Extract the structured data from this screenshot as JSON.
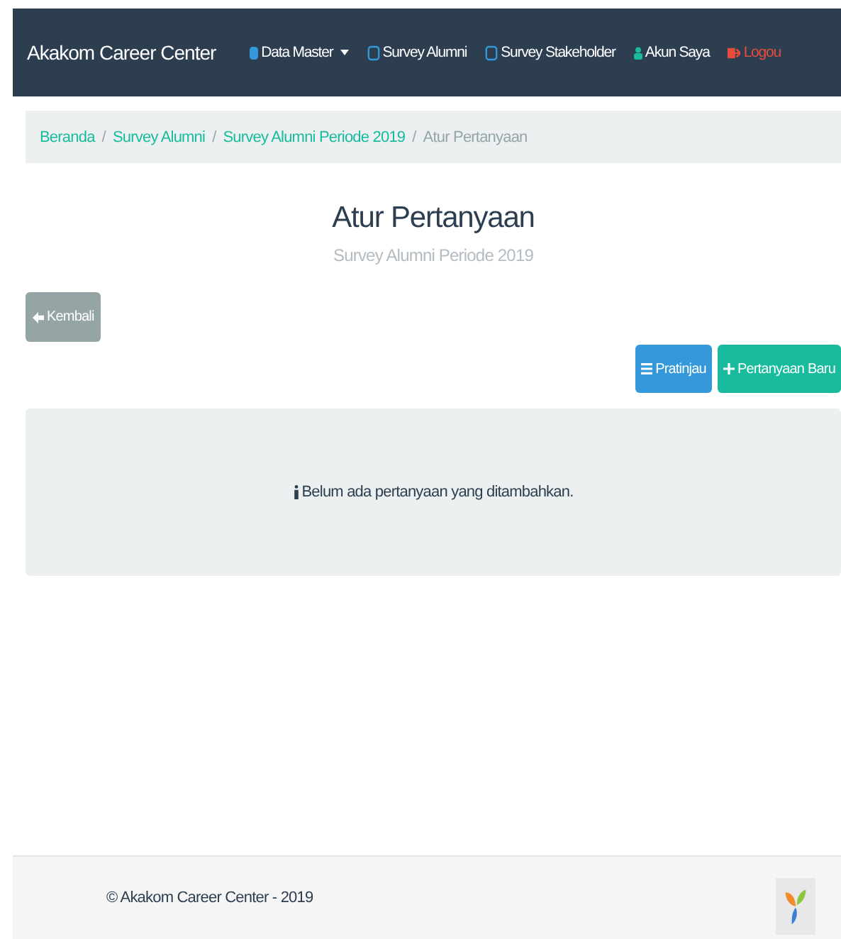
{
  "navbar": {
    "brand": "Akakom Career Center",
    "items": [
      {
        "label": "Data Master",
        "dropdown": true,
        "kind": "normal"
      },
      {
        "label": "Survey Alumni",
        "dropdown": false,
        "kind": "normal"
      },
      {
        "label": "Survey Stakeholder",
        "dropdown": false,
        "kind": "normal"
      },
      {
        "label": "Akun Saya",
        "dropdown": false,
        "kind": "normal"
      },
      {
        "label": "Logou",
        "dropdown": false,
        "kind": "danger"
      }
    ]
  },
  "breadcrumb_separators": [
    "/",
    "/",
    "/"
  ],
  "breadcrumb": [
    {
      "label": "Beranda",
      "active": false
    },
    {
      "label": "Survey Alumni",
      "active": false
    },
    {
      "label": "Survey Alumni Periode 2019",
      "active": false
    },
    {
      "label": "Atur Pertanyaan",
      "active": true
    }
  ],
  "page": {
    "title": "Atur Pertanyaan",
    "subtitle": "Survey Alumni Periode 2019"
  },
  "back_button": "Kembali",
  "actions": [
    {
      "label": "Pratinjau",
      "kind": "primary"
    },
    {
      "label": "Pertanyaan Baru",
      "kind": "success"
    }
  ],
  "empty_message": "Belum ada pertanyaan yang ditambahkan.",
  "footer": {
    "copyright": "© Akakom Career Center - 2019"
  }
}
